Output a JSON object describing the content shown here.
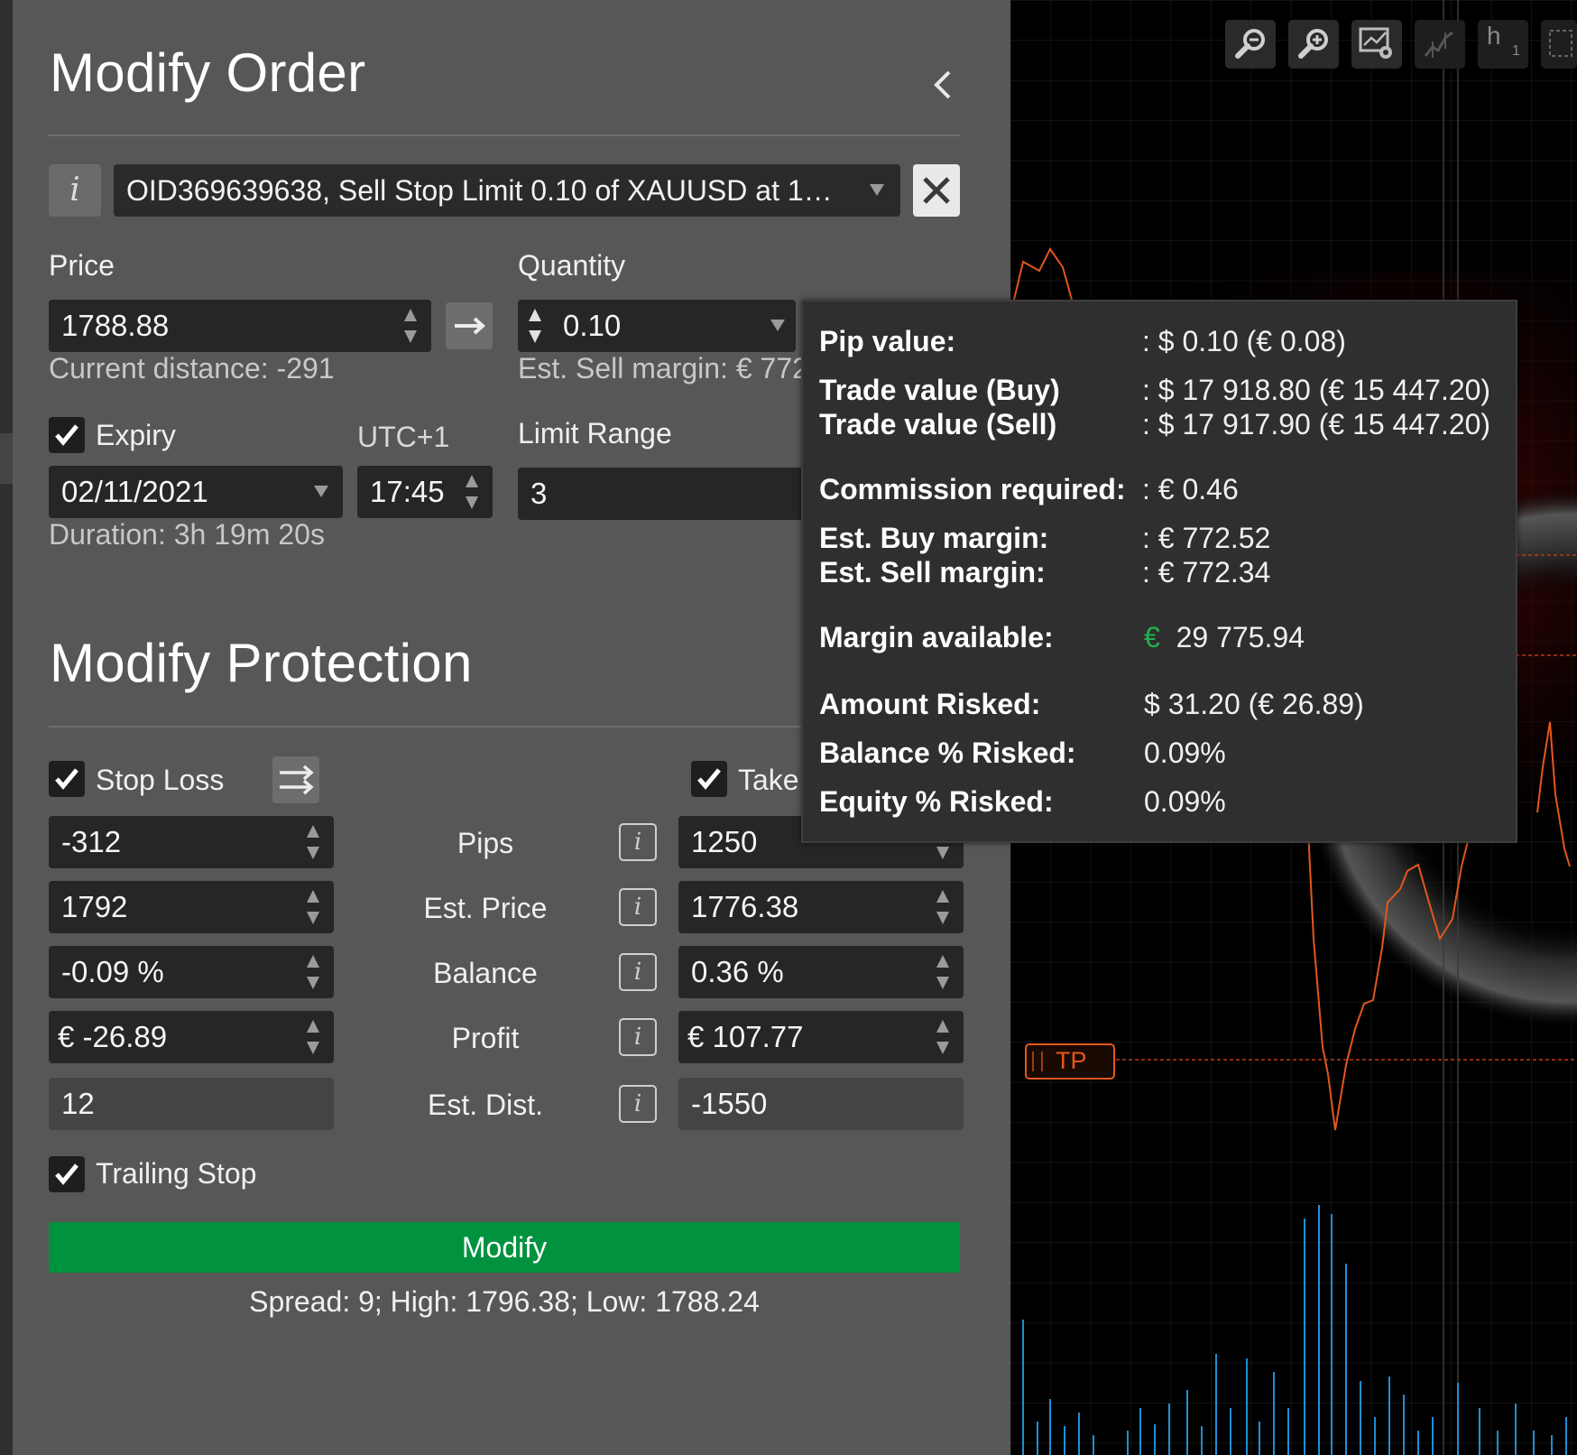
{
  "dialog": {
    "title": "Modify Order",
    "order_info_icon": "info-icon",
    "order_select_value": "OID369639638, Sell Stop Limit 0.10 of XAUUSD at 1…",
    "close_icon": "close-icon"
  },
  "order": {
    "price_label": "Price",
    "price_value": "1788.88",
    "current_distance": "Current distance: -291",
    "quantity_label": "Quantity",
    "quantity_value": "0.10",
    "est_sell_margin": "Est. Sell margin: € 772",
    "expiry_label": "Expiry",
    "expiry_checked": true,
    "timezone": "UTC+1",
    "expiry_date": "02/11/2021",
    "expiry_time": "17:45",
    "duration": "Duration: 3h 19m 20s",
    "limit_range_label": "Limit Range",
    "limit_range_value": "3"
  },
  "protection": {
    "title": "Modify Protection",
    "stop_loss_label": "Stop Loss",
    "take_profit_label": "Take",
    "rows": [
      {
        "label": "Pips",
        "sl": "-312",
        "tp": "1250"
      },
      {
        "label": "Est. Price",
        "sl": "1792",
        "tp": "1776.38"
      },
      {
        "label": "Balance",
        "sl": "-0.09 %",
        "tp": "0.36 %"
      },
      {
        "label": "Profit",
        "sl": "€ -26.89",
        "tp": "€ 107.77"
      },
      {
        "label": "Est. Dist.",
        "sl": "12",
        "tp": "-1550"
      }
    ],
    "trailing_stop_label": "Trailing Stop"
  },
  "actions": {
    "modify_label": "Modify",
    "spread_text": "Spread: 9; High: 1796.38; Low: 1788.24"
  },
  "tooltip": {
    "pip_value_label": "Pip value:",
    "pip_value": ": $ 0.10 (€ 0.08)",
    "trade_value_buy_label": "Trade value (Buy)",
    "trade_value_buy": ": $ 17 918.80 (€ 15 447.20)",
    "trade_value_sell_label": "Trade value (Sell)",
    "trade_value_sell": ": $ 17 917.90 (€ 15 447.20)",
    "commission_label": "Commission required:",
    "commission": ": € 0.46",
    "est_buy_margin_label": "Est. Buy margin:",
    "est_buy_margin": ": € 772.52",
    "est_sell_margin_label": "Est. Sell margin:",
    "est_sell_margin": ": € 772.34",
    "margin_available_label": "Margin available:",
    "margin_currency": "€",
    "margin_available": "29 775.94",
    "amount_risked_label": "Amount Risked:",
    "amount_risked": "$ 31.20 (€ 26.89)",
    "balance_risked_label": "Balance % Risked:",
    "balance_risked": "0.09%",
    "equity_risked_label": "Equity % Risked:",
    "equity_risked": "0.09%"
  },
  "chart": {
    "tp_label": "TP",
    "toolbar_h": "h",
    "toolbar_h_sub": "1",
    "accent_line": "#e2581c",
    "volume_color": "#1f8fd6"
  }
}
